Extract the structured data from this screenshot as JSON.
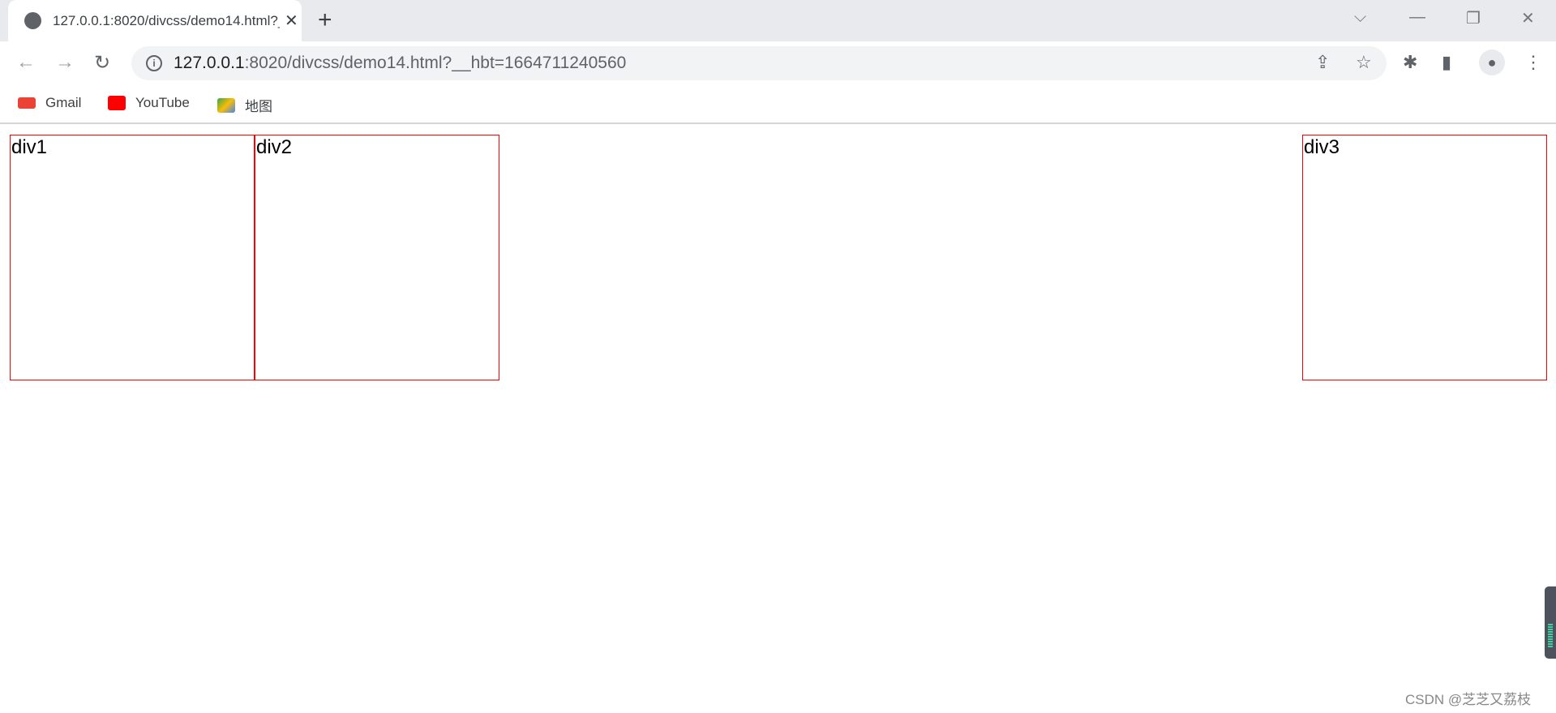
{
  "browser": {
    "tab_title": "127.0.0.1:8020/divcss/demo14.html?__hbt=1664711240560",
    "url_host": "127.0.0.1",
    "url_rest": ":8020/divcss/demo14.html?__hbt=1664711240560",
    "bookmarks": [
      {
        "label": "Gmail",
        "icon": "gmail-icon",
        "color": "#ea4335"
      },
      {
        "label": "YouTube",
        "icon": "youtube-icon",
        "color": "#ff0000"
      },
      {
        "label": "地图",
        "icon": "maps-icon",
        "color": "#34a853"
      }
    ]
  },
  "page": {
    "boxes": [
      "div1",
      "div2",
      "div3"
    ],
    "border_color": "#ff0000"
  },
  "watermark": "CSDN @芝芝又荔枝"
}
